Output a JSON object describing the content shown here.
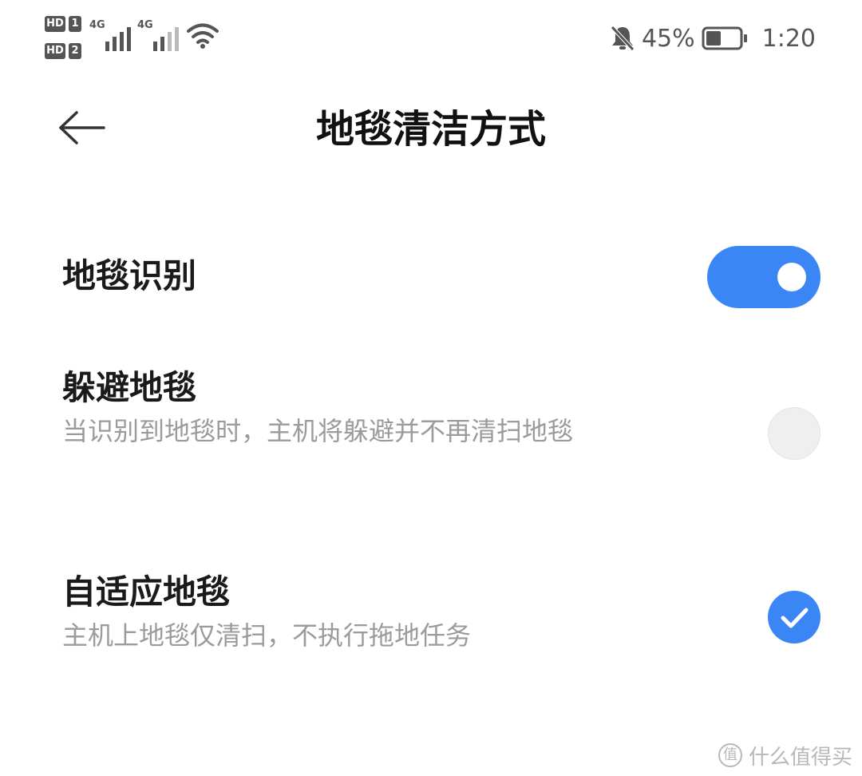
{
  "status_bar": {
    "sim1": {
      "hd": "HD",
      "slot": "1"
    },
    "sim2": {
      "hd": "HD",
      "slot": "2"
    },
    "signal1_tech": "4G",
    "signal2_tech": "4G",
    "battery_percent": "45%",
    "battery_level": 0.45,
    "time": "1:20",
    "icons": [
      "signal-icon",
      "wifi-icon",
      "bell-muted-icon",
      "battery-icon"
    ]
  },
  "header": {
    "title": "地毯清洁方式",
    "back_icon": "arrow-left-icon"
  },
  "settings": {
    "carpet_recognition": {
      "title": "地毯识别",
      "enabled": true
    },
    "options": [
      {
        "title": "躲避地毯",
        "description": "当识别到地毯时，主机将躲避并不再清扫地毯",
        "selected": false
      },
      {
        "title": "自适应地毯",
        "description": "主机上地毯仅清扫，不执行拖地任务",
        "selected": true
      }
    ]
  },
  "watermark": {
    "text": "什么值得买",
    "logo_glyph": "值"
  },
  "colors": {
    "accent": "#3a86f5",
    "text_primary": "#1a1a1a",
    "text_secondary": "#9b9b9b",
    "radio_off": "#efefef",
    "background": "#ffffff"
  }
}
